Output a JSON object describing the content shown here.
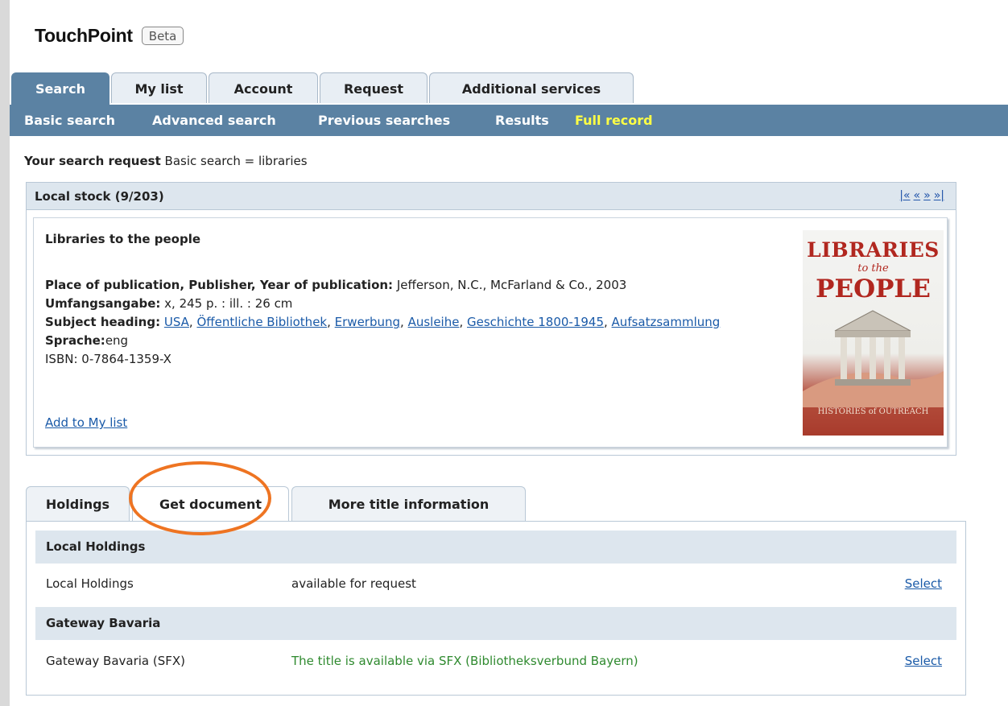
{
  "header": {
    "app_name": "TouchPoint",
    "badge": "Beta"
  },
  "main_tabs": [
    {
      "label": "Search",
      "active": true
    },
    {
      "label": "My list"
    },
    {
      "label": "Account"
    },
    {
      "label": "Request"
    },
    {
      "label": "Additional services"
    }
  ],
  "subnav": [
    {
      "label": "Basic search"
    },
    {
      "label": "Advanced search"
    },
    {
      "label": "Previous searches"
    },
    {
      "label": "Results"
    },
    {
      "label": "Full record",
      "current": true
    }
  ],
  "search_request": {
    "label": "Your search request",
    "value": "Basic search = libraries"
  },
  "record_box": {
    "title": "Local stock (9/203)",
    "pager": [
      "|«",
      "«",
      "»",
      "»|"
    ]
  },
  "record": {
    "title": "Libraries to the people",
    "publication_label": "Place of publication, Publisher, Year of publication:",
    "publication_value": "Jefferson, N.C., McFarland & Co., 2003",
    "extent_label": "Umfangsangabe:",
    "extent_value": "x, 245 p. : ill. : 26 cm",
    "subject_label": "Subject heading:",
    "subjects": [
      "USA",
      "Öffentliche Bibliothek",
      "Erwerbung",
      "Ausleihe",
      "Geschichte 1800-1945",
      "Aufsatzsammlung"
    ],
    "language_label": "Sprache:",
    "language_value": "eng",
    "isbn_label": "ISBN:",
    "isbn_value": "0-7864-1359-X",
    "add_to_list": "Add to My list"
  },
  "cover": {
    "line1": "LIBRARIES",
    "line2": "to the",
    "line3": "PEOPLE",
    "subtitle": "HISTORIES of OUTREACH"
  },
  "detail_tabs": [
    {
      "label": "Holdings"
    },
    {
      "label": "Get document",
      "active": true
    },
    {
      "label": "More title information"
    }
  ],
  "holdings": {
    "sections": [
      {
        "header": "Local Holdings",
        "row": {
          "name": "Local Holdings",
          "status": "available for request",
          "action": "Select"
        }
      },
      {
        "header": "Gateway Bavaria",
        "row": {
          "name": "Gateway Bavaria (SFX)",
          "status": "The title is available via SFX (Bibliotheksverbund Bayern)",
          "action": "Select"
        }
      }
    ]
  },
  "colors": {
    "nav": "#5b82a3",
    "current_link": "#ffff44",
    "annotation": "#ee7422",
    "available_text": "#2f8a2f"
  }
}
